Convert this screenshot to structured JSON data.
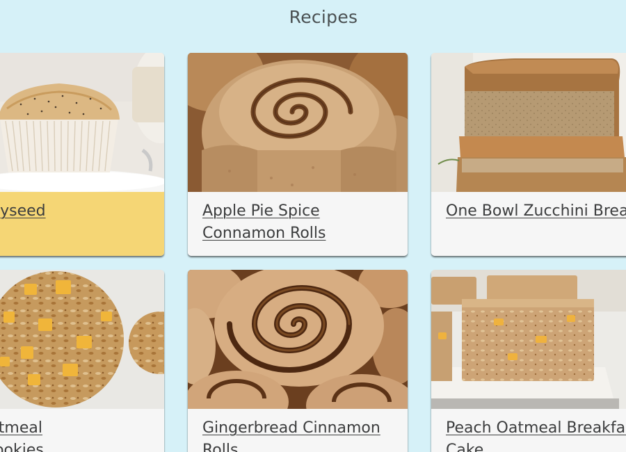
{
  "page": {
    "title": "Recipes"
  },
  "recipes": [
    {
      "title": "Lemon Poppyseed Muffins",
      "image": "lemon-poppyseed-muffin-photo"
    },
    {
      "title": "Apple Pie Spice Connamon Rolls",
      "image": "cinnamon-roll-photo"
    },
    {
      "title": "One Bowl Zucchini Bread",
      "image": "zucchini-bread-loaf-photo"
    },
    {
      "title": "Pumpkin Oatmeal Breakfast Cookies",
      "image": "oatmeal-cookies-photo"
    },
    {
      "title": "Gingerbread Cinnamon Rolls",
      "image": "gingerbread-cinnamon-rolls-photo"
    },
    {
      "title": "Peach Oatmeal Breakfast Cake",
      "image": "peach-oatmeal-bars-photo"
    }
  ],
  "colors": {
    "background": "#d6f1f8",
    "card": "#f6f6f6",
    "highlight": "#f5d675",
    "text": "#3c3d3e"
  }
}
